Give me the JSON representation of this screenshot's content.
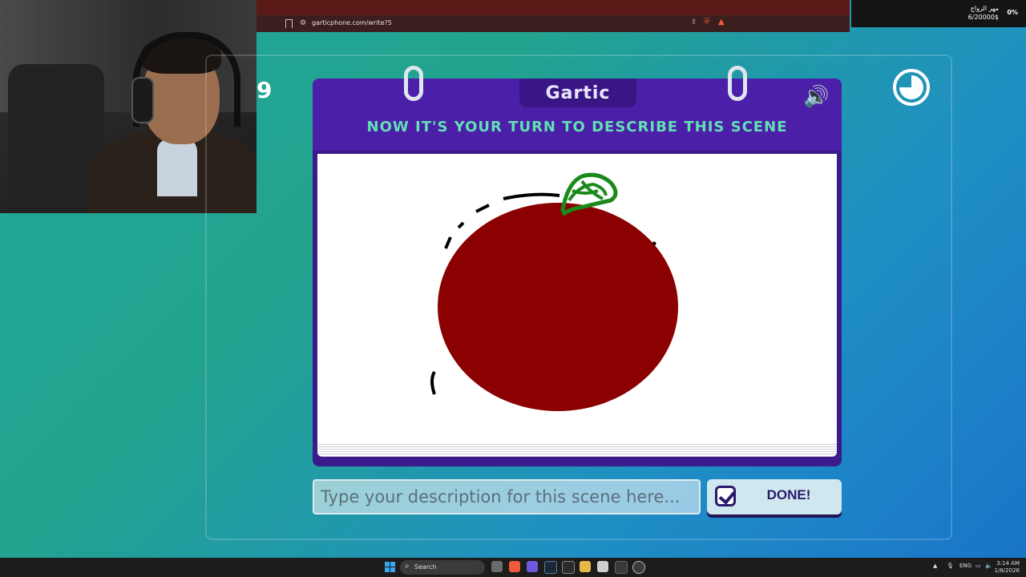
{
  "browser": {
    "url": "garticphone.com/write?5"
  },
  "stream_overlay": {
    "label": "مهر الزواج",
    "value": "6/20000$",
    "percent": "0%"
  },
  "game": {
    "timer_partial": "9",
    "logo": "Gartic",
    "heading": "NOW IT'S YOUR TURN TO DESCRIBE THIS SCENE",
    "description_placeholder": "Type your description for this scene here...",
    "done_label": "DONE!"
  },
  "drawing": {
    "fruit_color": "#8b0000",
    "leaf_color": "#1a8a1a",
    "outline_color": "#000000"
  },
  "taskbar": {
    "search_label": "Search",
    "language": "ENG",
    "time": "3:14 AM",
    "date": "1/8/2026"
  },
  "colors": {
    "card_purple": "#4b1fa8",
    "heading_green": "#62e0b4",
    "done_bg": "#cfe7ee"
  }
}
